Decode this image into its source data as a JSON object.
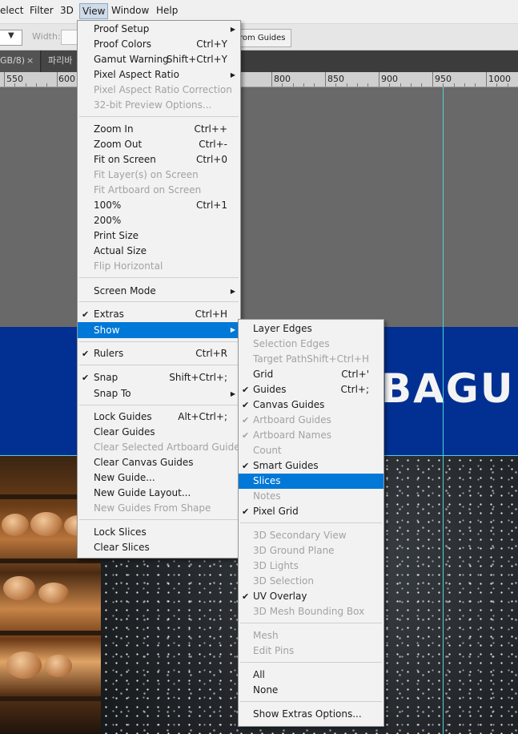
{
  "menubar": {
    "items": [
      "elect",
      "Filter",
      "3D",
      "View",
      "Window",
      "Help"
    ],
    "active": "View"
  },
  "options_bar": {
    "width_label": "Width:",
    "button_label": "rom Guides"
  },
  "tabs": [
    {
      "label": "GB/8)",
      "close": "×"
    },
    {
      "label": "파리바"
    }
  ],
  "ruler": {
    "labels": [
      "550",
      "600",
      "800",
      "850",
      "900",
      "950",
      "1000"
    ]
  },
  "canvas": {
    "banner_text": "BAGU",
    "banner_color": "#013092",
    "guide_color": "#4fd3d6"
  },
  "view_menu": {
    "items": [
      {
        "label": "Proof Setup",
        "shortcut": "",
        "submenu": true
      },
      {
        "label": "Proof Colors",
        "shortcut": "Ctrl+Y"
      },
      {
        "label": "Gamut Warning",
        "shortcut": "Shift+Ctrl+Y"
      },
      {
        "label": "Pixel Aspect Ratio",
        "shortcut": "",
        "submenu": true
      },
      {
        "label": "Pixel Aspect Ratio Correction",
        "disabled": true
      },
      {
        "label": "32-bit Preview Options...",
        "disabled": true
      },
      {
        "label": "Zoom In",
        "shortcut": "Ctrl++"
      },
      {
        "label": "Zoom Out",
        "shortcut": "Ctrl+-"
      },
      {
        "label": "Fit on Screen",
        "shortcut": "Ctrl+0"
      },
      {
        "label": "Fit Layer(s) on Screen",
        "disabled": true
      },
      {
        "label": "Fit Artboard on Screen",
        "disabled": true
      },
      {
        "label": "100%",
        "shortcut": "Ctrl+1"
      },
      {
        "label": "200%"
      },
      {
        "label": "Print Size"
      },
      {
        "label": "Actual Size"
      },
      {
        "label": "Flip Horizontal",
        "disabled": true
      },
      {
        "label": "Screen Mode",
        "submenu": true
      },
      {
        "label": "Extras",
        "shortcut": "Ctrl+H",
        "checked": true
      },
      {
        "label": "Show",
        "submenu": true,
        "highlighted": true
      },
      {
        "label": "Rulers",
        "shortcut": "Ctrl+R",
        "checked": true
      },
      {
        "label": "Snap",
        "shortcut": "Shift+Ctrl+;",
        "checked": true
      },
      {
        "label": "Snap To",
        "submenu": true
      },
      {
        "label": "Lock Guides",
        "shortcut": "Alt+Ctrl+;"
      },
      {
        "label": "Clear Guides"
      },
      {
        "label": "Clear Selected Artboard Guides",
        "disabled": true
      },
      {
        "label": "Clear Canvas Guides"
      },
      {
        "label": "New Guide..."
      },
      {
        "label": "New Guide Layout..."
      },
      {
        "label": "New Guides From Shape",
        "disabled": true
      },
      {
        "label": "Lock Slices"
      },
      {
        "label": "Clear Slices"
      }
    ]
  },
  "show_submenu": {
    "items": [
      {
        "label": "Layer Edges"
      },
      {
        "label": "Selection Edges",
        "disabled": true
      },
      {
        "label": "Target Path",
        "shortcut": "Shift+Ctrl+H",
        "disabled": true
      },
      {
        "label": "Grid",
        "shortcut": "Ctrl+'"
      },
      {
        "label": "Guides",
        "shortcut": "Ctrl+;",
        "checked": true
      },
      {
        "label": "Canvas Guides",
        "checked": true
      },
      {
        "label": "Artboard Guides",
        "checked": true,
        "disabled": true
      },
      {
        "label": "Artboard Names",
        "checked": true,
        "disabled": true
      },
      {
        "label": "Count",
        "disabled": true
      },
      {
        "label": "Smart Guides",
        "checked": true
      },
      {
        "label": "Slices",
        "highlighted": true
      },
      {
        "label": "Notes",
        "disabled": true
      },
      {
        "label": "Pixel Grid",
        "checked": true
      },
      {
        "label": "3D Secondary View",
        "disabled": true
      },
      {
        "label": "3D Ground Plane",
        "disabled": true
      },
      {
        "label": "3D Lights",
        "disabled": true
      },
      {
        "label": "3D Selection",
        "disabled": true
      },
      {
        "label": "UV Overlay",
        "checked": true
      },
      {
        "label": "3D Mesh Bounding Box",
        "disabled": true
      },
      {
        "label": "Mesh",
        "disabled": true
      },
      {
        "label": "Edit Pins",
        "disabled": true
      },
      {
        "label": "All"
      },
      {
        "label": "None"
      },
      {
        "label": "Show Extras Options..."
      }
    ]
  },
  "symbols": {
    "check": "✔",
    "arrow": "▶"
  }
}
